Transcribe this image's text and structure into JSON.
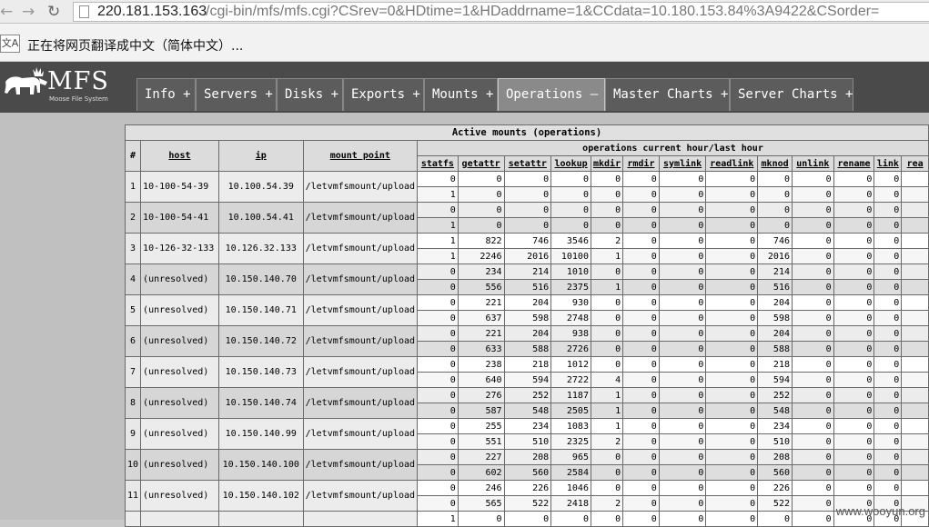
{
  "browser": {
    "url_host": "220.181.153.163",
    "url_path": "/cgi-bin/mfs/mfs.cgi?CSrev=0&HDtime=1&HDaddrname=1&CCdata=10.180.153.84%3A9422&CSorder=",
    "translate_message": "正在将网页翻译成中文（简体中文）..."
  },
  "logo": {
    "text": "MFS",
    "subtitle": "Moose File System"
  },
  "tabs": [
    {
      "label": "Info +"
    },
    {
      "label": "Servers +"
    },
    {
      "label": "Disks +"
    },
    {
      "label": "Exports +"
    },
    {
      "label": "Mounts +"
    },
    {
      "label": "Operations —"
    },
    {
      "label": "Master Charts +"
    },
    {
      "label": "Server Charts +"
    }
  ],
  "table": {
    "title": "Active mounts (operations)",
    "ops_header": "operations current hour/last hour",
    "columns": {
      "idx": "#",
      "host": "host",
      "ip": "ip",
      "mount_point": "mount point"
    },
    "op_columns": [
      "statfs",
      "getattr",
      "setattr",
      "lookup",
      "mkdir",
      "rmdir",
      "symlink",
      "readlink",
      "mknod",
      "unlink",
      "rename",
      "link",
      "rea"
    ],
    "rows": [
      {
        "idx": "1",
        "host": "10-100-54-39",
        "ip": "10.100.54.39",
        "mp": "/letvmfsmount/upload",
        "cur": [
          "0",
          "0",
          "0",
          "0",
          "0",
          "0",
          "0",
          "0",
          "0",
          "0",
          "0",
          "0",
          ""
        ],
        "last": [
          "1",
          "0",
          "0",
          "0",
          "0",
          "0",
          "0",
          "0",
          "0",
          "0",
          "0",
          "0",
          ""
        ]
      },
      {
        "idx": "2",
        "host": "10-100-54-41",
        "ip": "10.100.54.41",
        "mp": "/letvmfsmount/upload",
        "cur": [
          "0",
          "0",
          "0",
          "0",
          "0",
          "0",
          "0",
          "0",
          "0",
          "0",
          "0",
          "0",
          ""
        ],
        "last": [
          "1",
          "0",
          "0",
          "0",
          "0",
          "0",
          "0",
          "0",
          "0",
          "0",
          "0",
          "0",
          ""
        ]
      },
      {
        "idx": "3",
        "host": "10-126-32-133",
        "ip": "10.126.32.133",
        "mp": "/letvmfsmount/upload",
        "cur": [
          "1",
          "822",
          "746",
          "3546",
          "2",
          "0",
          "0",
          "0",
          "746",
          "0",
          "0",
          "0",
          ""
        ],
        "last": [
          "1",
          "2246",
          "2016",
          "10100",
          "1",
          "0",
          "0",
          "0",
          "2016",
          "0",
          "0",
          "0",
          ""
        ]
      },
      {
        "idx": "4",
        "host": "(unresolved)",
        "ip": "10.150.140.70",
        "mp": "/letvmfsmount/upload",
        "cur": [
          "0",
          "234",
          "214",
          "1010",
          "0",
          "0",
          "0",
          "0",
          "214",
          "0",
          "0",
          "0",
          ""
        ],
        "last": [
          "0",
          "556",
          "516",
          "2375",
          "1",
          "0",
          "0",
          "0",
          "516",
          "0",
          "0",
          "0",
          ""
        ]
      },
      {
        "idx": "5",
        "host": "(unresolved)",
        "ip": "10.150.140.71",
        "mp": "/letvmfsmount/upload",
        "cur": [
          "0",
          "221",
          "204",
          "930",
          "0",
          "0",
          "0",
          "0",
          "204",
          "0",
          "0",
          "0",
          ""
        ],
        "last": [
          "0",
          "637",
          "598",
          "2748",
          "0",
          "0",
          "0",
          "0",
          "598",
          "0",
          "0",
          "0",
          ""
        ]
      },
      {
        "idx": "6",
        "host": "(unresolved)",
        "ip": "10.150.140.72",
        "mp": "/letvmfsmount/upload",
        "cur": [
          "0",
          "221",
          "204",
          "938",
          "0",
          "0",
          "0",
          "0",
          "204",
          "0",
          "0",
          "0",
          ""
        ],
        "last": [
          "0",
          "633",
          "588",
          "2726",
          "0",
          "0",
          "0",
          "0",
          "588",
          "0",
          "0",
          "0",
          ""
        ]
      },
      {
        "idx": "7",
        "host": "(unresolved)",
        "ip": "10.150.140.73",
        "mp": "/letvmfsmount/upload",
        "cur": [
          "0",
          "238",
          "218",
          "1012",
          "0",
          "0",
          "0",
          "0",
          "218",
          "0",
          "0",
          "0",
          ""
        ],
        "last": [
          "0",
          "640",
          "594",
          "2722",
          "4",
          "0",
          "0",
          "0",
          "594",
          "0",
          "0",
          "0",
          ""
        ]
      },
      {
        "idx": "8",
        "host": "(unresolved)",
        "ip": "10.150.140.74",
        "mp": "/letvmfsmount/upload",
        "cur": [
          "0",
          "276",
          "252",
          "1187",
          "1",
          "0",
          "0",
          "0",
          "252",
          "0",
          "0",
          "0",
          ""
        ],
        "last": [
          "0",
          "587",
          "548",
          "2505",
          "1",
          "0",
          "0",
          "0",
          "548",
          "0",
          "0",
          "0",
          ""
        ]
      },
      {
        "idx": "9",
        "host": "(unresolved)",
        "ip": "10.150.140.99",
        "mp": "/letvmfsmount/upload",
        "cur": [
          "0",
          "255",
          "234",
          "1083",
          "1",
          "0",
          "0",
          "0",
          "234",
          "0",
          "0",
          "0",
          ""
        ],
        "last": [
          "0",
          "551",
          "510",
          "2325",
          "2",
          "0",
          "0",
          "0",
          "510",
          "0",
          "0",
          "0",
          ""
        ]
      },
      {
        "idx": "10",
        "host": "(unresolved)",
        "ip": "10.150.140.100",
        "mp": "/letvmfsmount/upload",
        "cur": [
          "0",
          "227",
          "208",
          "965",
          "0",
          "0",
          "0",
          "0",
          "208",
          "0",
          "0",
          "0",
          ""
        ],
        "last": [
          "0",
          "602",
          "560",
          "2584",
          "0",
          "0",
          "0",
          "0",
          "560",
          "0",
          "0",
          "0",
          ""
        ]
      },
      {
        "idx": "11",
        "host": "(unresolved)",
        "ip": "10.150.140.102",
        "mp": "/letvmfsmount/upload",
        "cur": [
          "0",
          "246",
          "226",
          "1046",
          "0",
          "0",
          "0",
          "0",
          "226",
          "0",
          "0",
          "0",
          ""
        ],
        "last": [
          "0",
          "565",
          "522",
          "2418",
          "2",
          "0",
          "0",
          "0",
          "522",
          "0",
          "0",
          "0",
          ""
        ]
      }
    ],
    "partial_row": [
      "1",
      "0",
      "0",
      "0",
      "0",
      "0",
      "0",
      "0",
      "0",
      "0",
      "0",
      "0",
      ""
    ]
  },
  "watermark": "www.wooyun.org"
}
